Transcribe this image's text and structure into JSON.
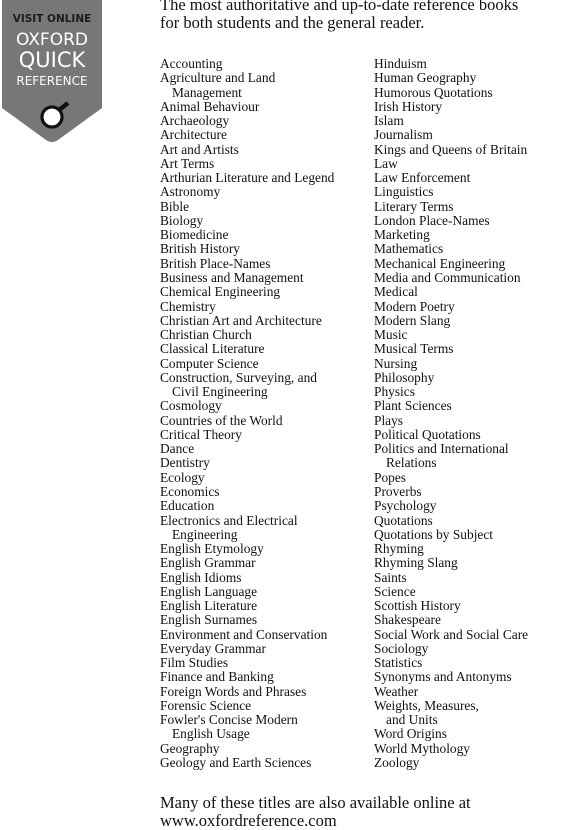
{
  "badge": {
    "line1": "VISIT ONLINE",
    "line2": "OXFORD",
    "line3": "QUICK",
    "line4": "REFERENCE",
    "icon": "magnifier-icon",
    "colors": {
      "background": "#77777a",
      "dark_text": "#1c1c1c",
      "light_text": "#ffffff"
    }
  },
  "intro": {
    "line1": "The most authoritative and up-to-date reference books",
    "line2": "for both students and the general reader."
  },
  "subjects_left": [
    {
      "label": "Accounting"
    },
    {
      "label": "Agriculture and Land",
      "cont": "Management"
    },
    {
      "label": "Animal Behaviour"
    },
    {
      "label": "Archaeology"
    },
    {
      "label": "Architecture"
    },
    {
      "label": "Art and Artists"
    },
    {
      "label": "Art Terms"
    },
    {
      "label": "Arthurian Literature and Legend"
    },
    {
      "label": "Astronomy"
    },
    {
      "label": "Bible"
    },
    {
      "label": "Biology"
    },
    {
      "label": "Biomedicine"
    },
    {
      "label": "British History"
    },
    {
      "label": "British Place-Names"
    },
    {
      "label": "Business and Management"
    },
    {
      "label": "Chemical Engineering"
    },
    {
      "label": "Chemistry"
    },
    {
      "label": "Christian Art and Architecture"
    },
    {
      "label": "Christian Church"
    },
    {
      "label": "Classical Literature"
    },
    {
      "label": "Computer Science"
    },
    {
      "label": "Construction, Surveying, and",
      "cont": "Civil Engineering"
    },
    {
      "label": "Cosmology"
    },
    {
      "label": "Countries of the World"
    },
    {
      "label": "Critical Theory"
    },
    {
      "label": "Dance"
    },
    {
      "label": "Dentistry"
    },
    {
      "label": "Ecology"
    },
    {
      "label": "Economics"
    },
    {
      "label": "Education"
    },
    {
      "label": "Electronics and Electrical",
      "cont": "Engineering"
    },
    {
      "label": "English Etymology"
    },
    {
      "label": "English Grammar"
    },
    {
      "label": "English Idioms"
    },
    {
      "label": "English Language"
    },
    {
      "label": "English Literature"
    },
    {
      "label": "English Surnames"
    },
    {
      "label": "Environment and Conservation"
    },
    {
      "label": "Everyday Grammar"
    },
    {
      "label": "Film Studies"
    },
    {
      "label": "Finance and Banking"
    },
    {
      "label": "Foreign Words and Phrases"
    },
    {
      "label": "Forensic Science"
    },
    {
      "label": "Fowler's Concise Modern",
      "cont": "English Usage"
    },
    {
      "label": "Geography"
    },
    {
      "label": "Geology and Earth Sciences"
    }
  ],
  "subjects_right": [
    {
      "label": "Hinduism"
    },
    {
      "label": "Human Geography"
    },
    {
      "label": "Humorous Quotations"
    },
    {
      "label": "Irish History"
    },
    {
      "label": "Islam"
    },
    {
      "label": "Journalism"
    },
    {
      "label": "Kings and Queens of Britain"
    },
    {
      "label": "Law"
    },
    {
      "label": "Law Enforcement"
    },
    {
      "label": "Linguistics"
    },
    {
      "label": "Literary Terms"
    },
    {
      "label": "London Place-Names"
    },
    {
      "label": "Marketing"
    },
    {
      "label": "Mathematics"
    },
    {
      "label": "Mechanical Engineering"
    },
    {
      "label": "Media and Communication"
    },
    {
      "label": "Medical"
    },
    {
      "label": "Modern Poetry"
    },
    {
      "label": "Modern Slang"
    },
    {
      "label": "Music"
    },
    {
      "label": "Musical Terms"
    },
    {
      "label": "Nursing"
    },
    {
      "label": "Philosophy"
    },
    {
      "label": "Physics"
    },
    {
      "label": "Plant Sciences"
    },
    {
      "label": "Plays"
    },
    {
      "label": "Political Quotations"
    },
    {
      "label": "Politics and International",
      "cont": "Relations"
    },
    {
      "label": "Popes"
    },
    {
      "label": "Proverbs"
    },
    {
      "label": "Psychology"
    },
    {
      "label": "Quotations"
    },
    {
      "label": "Quotations by Subject"
    },
    {
      "label": "Rhyming"
    },
    {
      "label": "Rhyming Slang"
    },
    {
      "label": "Saints"
    },
    {
      "label": "Science"
    },
    {
      "label": "Scottish History"
    },
    {
      "label": "Shakespeare"
    },
    {
      "label": "Social Work and Social Care"
    },
    {
      "label": "Sociology"
    },
    {
      "label": "Statistics"
    },
    {
      "label": "Synonyms and Antonyms"
    },
    {
      "label": "Weather"
    },
    {
      "label": "Weights, Measures,",
      "cont": "and Units"
    },
    {
      "label": "Word Origins"
    },
    {
      "label": "World Mythology"
    },
    {
      "label": "Zoology"
    }
  ],
  "footer": {
    "line1": "Many of these titles are also available online at",
    "line2": "www.oxfordreference.com"
  }
}
